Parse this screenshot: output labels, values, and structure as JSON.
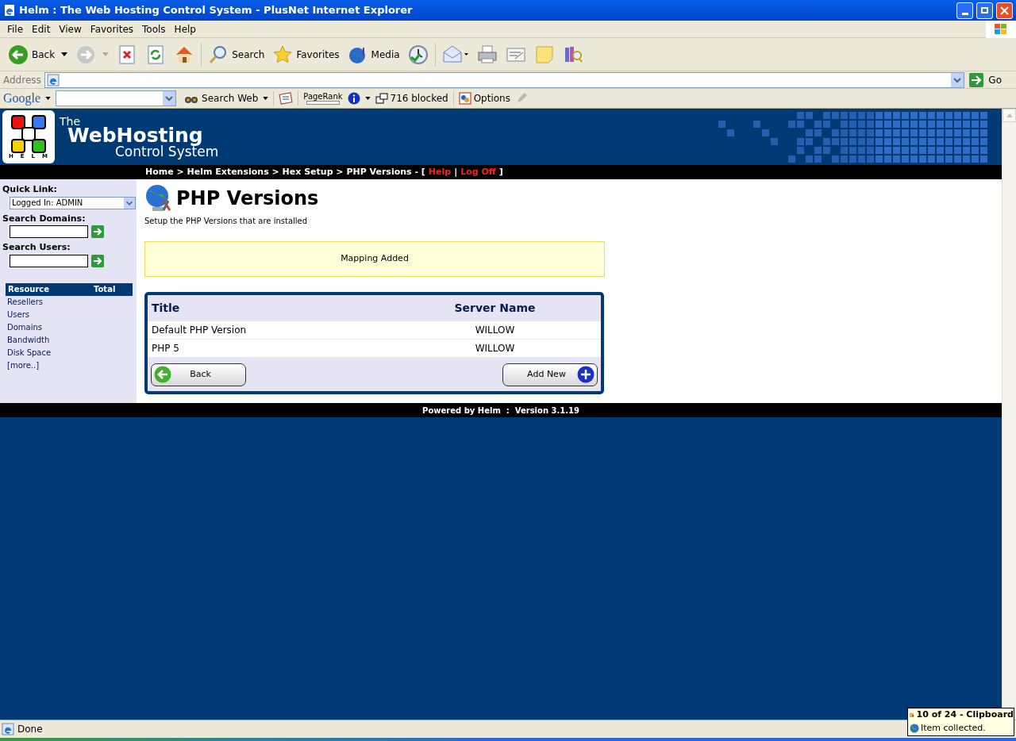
{
  "window": {
    "title": "Helm : The Web Hosting Control System - PlusNet Internet Explorer"
  },
  "menu": [
    "File",
    "Edit",
    "View",
    "Favorites",
    "Tools",
    "Help"
  ],
  "toolbar": [
    {
      "kind": "back",
      "label": "Back"
    },
    {
      "kind": "forward"
    },
    {
      "kind": "stop"
    },
    {
      "kind": "refresh"
    },
    {
      "kind": "home"
    },
    {
      "kind": "search",
      "label": "Search"
    },
    {
      "kind": "favorites",
      "label": "Favorites"
    },
    {
      "kind": "media",
      "label": "Media"
    },
    {
      "kind": "history"
    },
    {
      "kind": "mail"
    },
    {
      "kind": "print"
    },
    {
      "kind": "edit"
    },
    {
      "kind": "note"
    },
    {
      "kind": "research"
    }
  ],
  "address": {
    "label": "Address",
    "go": "Go"
  },
  "google_bar": {
    "brand": "Google",
    "search_web": "Search Web",
    "pagerank": "PageRank",
    "blocked": "716 blocked",
    "options": "Options"
  },
  "header": {
    "logo_letters": "HELM",
    "line_1": "The",
    "line_2": "WebHosting",
    "line_3": "Control System"
  },
  "breadcrumb": {
    "path": "Home > Helm Extensions > Hex Setup > PHP Versions - [",
    "links": [
      "Help",
      "Log Off"
    ],
    "separator": "|",
    "close": "]"
  },
  "sidebar": {
    "quick_link": {
      "label": "Quick Link:",
      "value": "Logged In: ADMIN"
    },
    "search_domains": {
      "label": "Search Domains:"
    },
    "search_users": {
      "label": "Search Users:"
    },
    "resources": {
      "columns": [
        "Resource",
        "Total"
      ],
      "items": [
        "Resellers",
        "Users",
        "Domains",
        "Bandwidth",
        "Disk Space",
        "[more..]"
      ]
    }
  },
  "main": {
    "title": "PHP Versions",
    "subtitle": "Setup the PHP Versions that are installed",
    "message": "Mapping Added",
    "table": {
      "columns": [
        "Title",
        "Server Name"
      ],
      "rows": [
        [
          "Default PHP Version",
          "WILLOW"
        ],
        [
          "PHP 5",
          "WILLOW"
        ]
      ]
    },
    "buttons": {
      "back": "Back",
      "add_new": "Add New"
    }
  },
  "footer": "Powered by Helm  :  Version 3.1.19",
  "status_bar": {
    "text": "Done"
  },
  "notification": {
    "title": "10 of 24 - Clipboard",
    "text": "Item collected."
  }
}
